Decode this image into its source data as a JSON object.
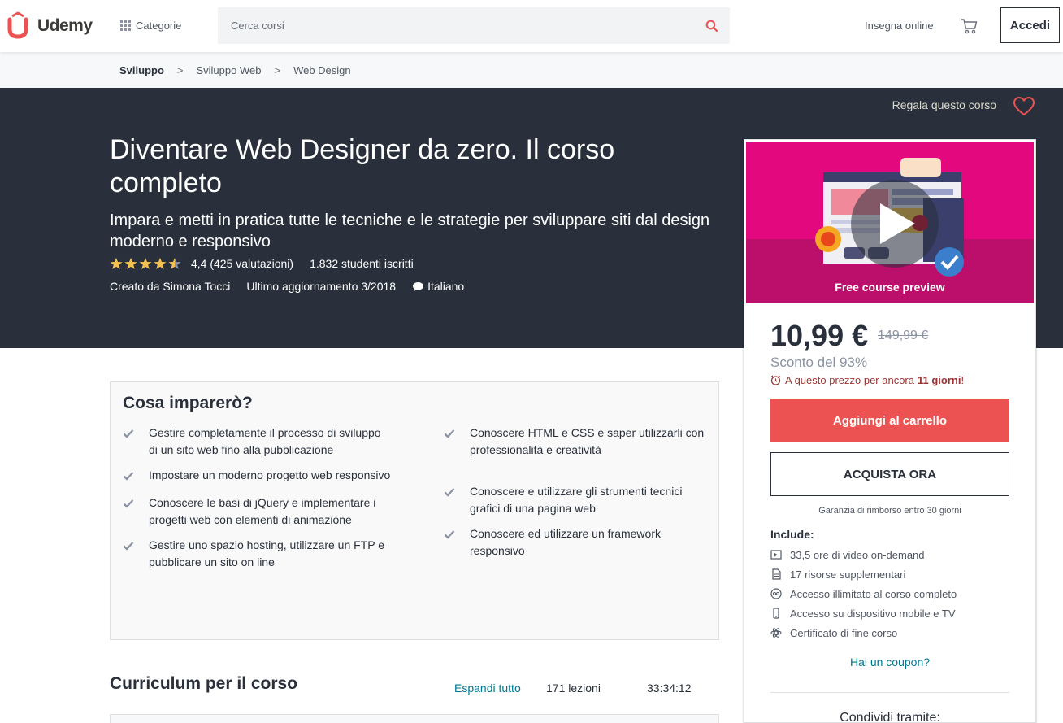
{
  "header": {
    "brand": "Udemy",
    "categories_label": "Categorie",
    "search_placeholder": "Cerca corsi",
    "teach_label": "Insegna online",
    "login_label": "Accedi",
    "accent_color": "#ec5252"
  },
  "breadcrumb": {
    "items": [
      "Sviluppo",
      "Sviluppo Web",
      "Web Design"
    ],
    "separator": ">"
  },
  "hero": {
    "gift_label": "Regala questo corso",
    "title": "Diventare Web Designer da zero. Il corso completo",
    "subtitle": "Impara e metti in pratica tutte le tecniche e le strategie per sviluppare siti dal design moderno e responsivo",
    "rating_stars": 4.4,
    "rating_text": "4,4 (425 valutazioni)",
    "students": "1.832 studenti iscritti",
    "created_by_label": "Creato da",
    "author": "Simona Tocci",
    "updated": "Ultimo aggiornamento 3/2018",
    "language": "Italiano"
  },
  "card": {
    "preview_label": "Free course preview",
    "price": "10,99 €",
    "original_price": "149,99 €",
    "discount": "Sconto del 93%",
    "timer_prefix": "A questo prezzo per ancora",
    "timer_value": "11 giorni",
    "timer_suffix": "!",
    "add_to_cart": "Aggiungi al carrello",
    "buy_now": "ACQUISTA ORA",
    "guarantee": "Garanzia di rimborso entro 30 giorni",
    "includes_title": "Include:",
    "includes": [
      {
        "icon": "video-icon",
        "label": "33,5 ore di video on-demand"
      },
      {
        "icon": "file-icon",
        "label": "17 risorse supplementari"
      },
      {
        "icon": "infinity-icon",
        "label": "Accesso illimitato al corso completo"
      },
      {
        "icon": "mobile-icon",
        "label": "Accesso su dispositivo mobile e TV"
      },
      {
        "icon": "certificate-icon",
        "label": "Certificato di fine corso"
      }
    ],
    "coupon": "Hai un coupon?",
    "share": "Condividi tramite:"
  },
  "learn": {
    "title": "Cosa imparerò?",
    "left": [
      "Gestire completamente il processo di sviluppo di un sito web fino alla pubblicazione",
      "Impostare un moderno progetto web responsivo",
      "Conoscere le basi di jQuery e implementare i progetti web con elementi di animazione",
      "Gestire uno spazio hosting, utilizzare un FTP e pubblicare un sito on line"
    ],
    "right": [
      "Conoscere HTML e CSS e saper utilizzarli con professionalità e creatività",
      "Conoscere e utilizzare gli strumenti tecnici grafici di una pagina web",
      "Conoscere ed utilizzare un framework responsivo"
    ]
  },
  "curriculum": {
    "title": "Curriculum per il corso",
    "expand_label": "Espandi tutto",
    "lessons": "171 lezioni",
    "duration": "33:34:12"
  }
}
